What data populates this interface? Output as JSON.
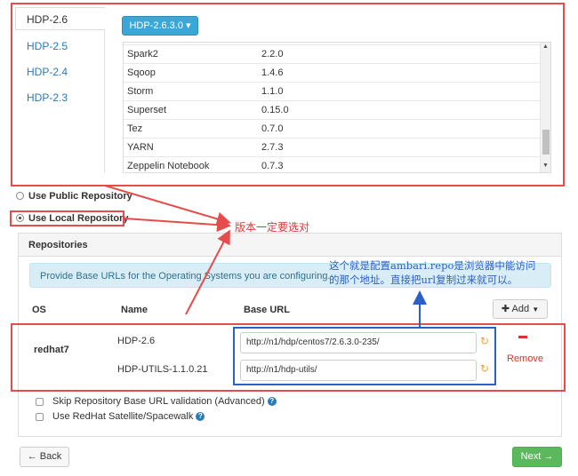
{
  "version_tabs": [
    "HDP-2.6",
    "HDP-2.5",
    "HDP-2.4",
    "HDP-2.3"
  ],
  "stack_version_button": "HDP-2.6.3.0 ▾",
  "services": [
    {
      "name": "Spark2",
      "version": "2.2.0"
    },
    {
      "name": "Sqoop",
      "version": "1.4.6"
    },
    {
      "name": "Storm",
      "version": "1.1.0"
    },
    {
      "name": "Superset",
      "version": "0.15.0"
    },
    {
      "name": "Tez",
      "version": "0.7.0"
    },
    {
      "name": "YARN",
      "version": "2.7.3"
    },
    {
      "name": "Zeppelin Notebook",
      "version": "0.7.3"
    }
  ],
  "repo_options": {
    "public": "Use Public Repository",
    "local": "Use Local Repository"
  },
  "repositories": {
    "title": "Repositories",
    "info": "Provide Base URLs for the Operating Systems you are configuring.",
    "col_os": "OS",
    "col_name": "Name",
    "col_base_url": "Base URL",
    "add_label": "Add",
    "os": "redhat7",
    "rows": [
      {
        "name": "HDP-2.6",
        "url": "http://n1/hdp/centos7/2.6.3.0-235/"
      },
      {
        "name": "HDP-UTILS-1.1.0.21",
        "url": "http://n1/hdp-utils/"
      }
    ],
    "remove_label": "Remove"
  },
  "options": {
    "skip_validation": "Skip Repository Base URL validation (Advanced)",
    "use_satellite": "Use RedHat Satellite/Spacewalk"
  },
  "nav": {
    "back": "← Back",
    "next": "Next →"
  },
  "annotations": {
    "version_note": "版本一定要选对",
    "repo_note_1": "这个就是配置ambari.repo是浏览器中能访问",
    "repo_note_2": "的那个地址。直接把url复制过来就可以。"
  },
  "colors": {
    "annotation_red": "#e74c4c",
    "annotation_blue": "#2c5fc9",
    "primary": "#3ba7d6",
    "success": "#5cb85c"
  }
}
